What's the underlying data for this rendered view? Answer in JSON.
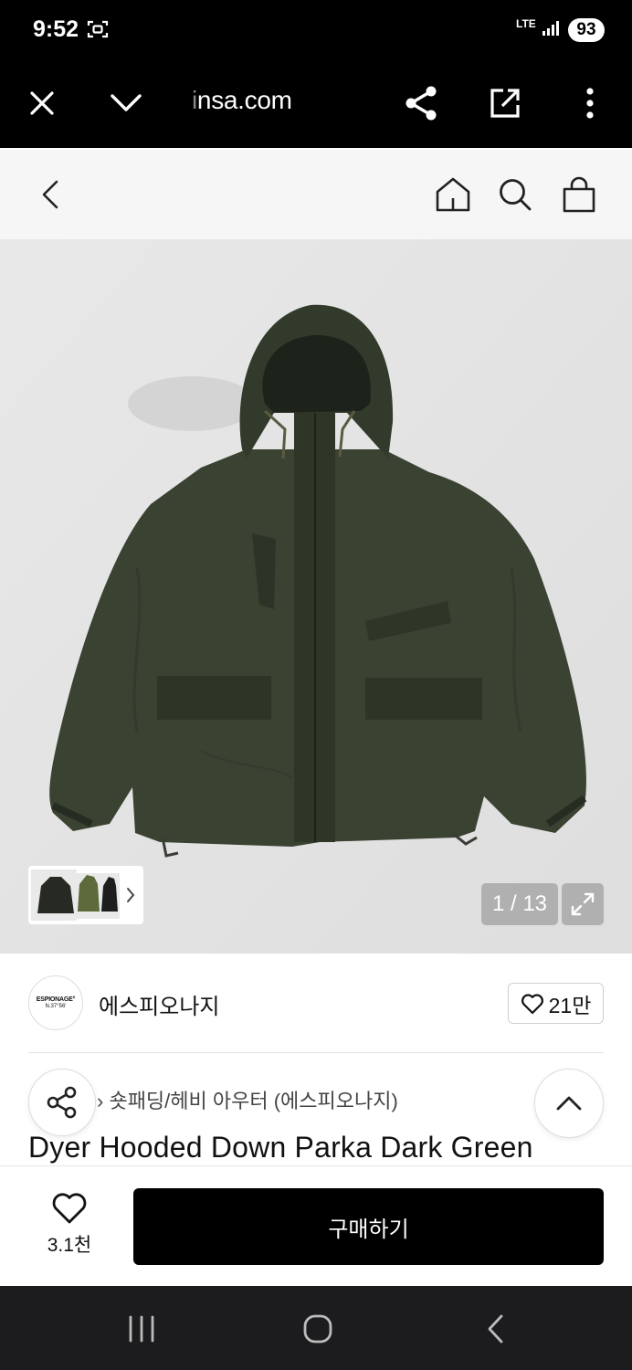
{
  "status_bar": {
    "time": "9:52",
    "network": "LTE",
    "battery": "93"
  },
  "browser": {
    "url_faded": "i",
    "url": "nsa.com"
  },
  "gallery": {
    "counter": "1 / 13",
    "product_color": "#3a4232"
  },
  "brand": {
    "logo_line1": "ESPIONAGE°",
    "logo_line2": "N.37°56'",
    "name": "에스피오나지",
    "likes": "21만"
  },
  "product": {
    "category": "숏패딩/헤비 아우터 (에스피오나지)",
    "title": "Dyer Hooded Down Parka Dark Green"
  },
  "purchase_bar": {
    "like_count": "3.1천",
    "buy_label": "구매하기"
  }
}
